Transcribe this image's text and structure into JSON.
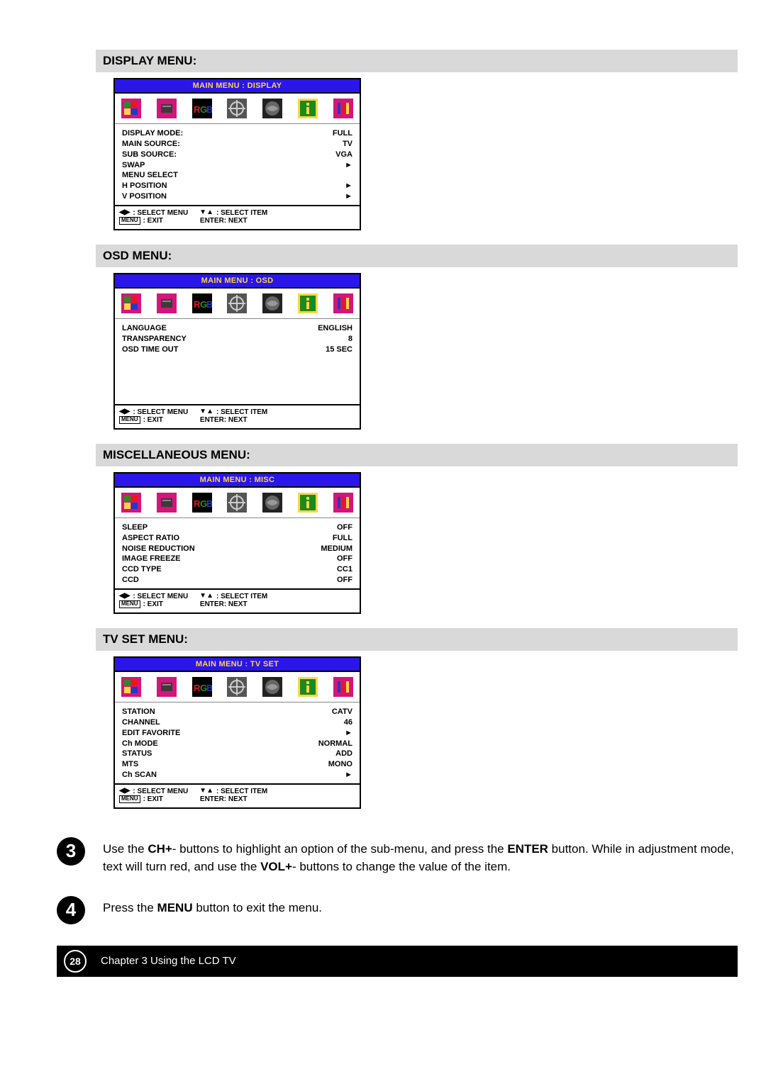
{
  "sections": {
    "display": {
      "title": "DISPLAY MENU:"
    },
    "osd": {
      "title": "OSD MENU:"
    },
    "misc": {
      "title": "MISCELLANEOUS MENU:"
    },
    "tvset": {
      "title": "TV SET MENU:"
    }
  },
  "menus": {
    "display": {
      "header": "MAIN MENU : DISPLAY",
      "rows": [
        {
          "label": "DISPLAY MODE:",
          "value": "FULL"
        },
        {
          "label": "MAIN SOURCE:",
          "value": "TV"
        },
        {
          "label": "SUB SOURCE:",
          "value": "VGA"
        },
        {
          "label": "SWAP",
          "value": "►"
        },
        {
          "label": "MENU SELECT",
          "value": ""
        },
        {
          "label": "H POSITION",
          "value": "►"
        },
        {
          "label": "V POSITION",
          "value": "►"
        }
      ]
    },
    "osd": {
      "header": "MAIN MENU : OSD",
      "rows": [
        {
          "label": "LANGUAGE",
          "value": "ENGLISH"
        },
        {
          "label": "TRANSPARENCY",
          "value": "8"
        },
        {
          "label": "OSD TIME OUT",
          "value": "15 SEC"
        }
      ]
    },
    "misc": {
      "header": "MAIN MENU : MISC",
      "rows": [
        {
          "label": "SLEEP",
          "value": "OFF"
        },
        {
          "label": "ASPECT RATIO",
          "value": "FULL"
        },
        {
          "label": "NOISE REDUCTION",
          "value": "MEDIUM"
        },
        {
          "label": "IMAGE FREEZE",
          "value": "OFF"
        },
        {
          "label": "CCD TYPE",
          "value": "CC1"
        },
        {
          "label": "CCD",
          "value": "OFF"
        }
      ]
    },
    "tvset": {
      "header": "MAIN MENU : TV SET",
      "rows": [
        {
          "label": "STATION",
          "value": "CATV"
        },
        {
          "label": "CHANNEL",
          "value": "46"
        },
        {
          "label": "EDIT FAVORITE",
          "value": "►"
        },
        {
          "label": "Ch MODE",
          "value": "NORMAL"
        },
        {
          "label": "STATUS",
          "value": "ADD"
        },
        {
          "label": "MTS",
          "value": "MONO"
        },
        {
          "label": "Ch SCAN",
          "value": "►"
        }
      ]
    }
  },
  "hints": {
    "select_menu": ": SELECT MENU",
    "select_item": ": SELECT ITEM",
    "exit": ": EXIT",
    "enter_next": "ENTER: NEXT",
    "menu_chip": "MENU"
  },
  "steps": {
    "s3": {
      "num": "3",
      "pre": "Use the ",
      "b1": "CH+",
      "mid1": "- buttons to highlight an option of the sub-menu, and press the ",
      "b2": "ENTER",
      "mid2": " button. While in adjustment mode, text will turn red, and use the ",
      "b3": "VOL+",
      "mid3": "- buttons to change the value of the item."
    },
    "s4": {
      "num": "4",
      "pre": "Press the ",
      "b1": "MENU",
      "post": " button to exit the menu."
    }
  },
  "footer": {
    "page": "28",
    "chapter": "Chapter 3 Using the LCD TV"
  }
}
